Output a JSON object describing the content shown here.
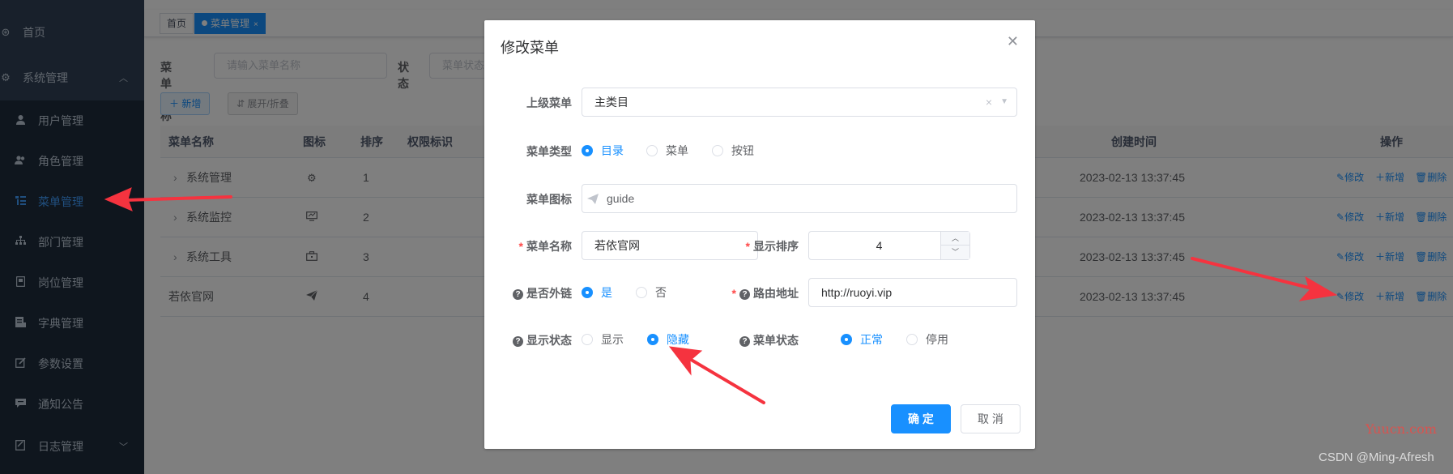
{
  "sidebar": {
    "home": "首页",
    "system": "系统管理",
    "items": [
      {
        "label": "用户管理",
        "icon": "user-icon"
      },
      {
        "label": "角色管理",
        "icon": "peoples-icon"
      },
      {
        "label": "菜单管理",
        "icon": "tree-table-icon",
        "active": true
      },
      {
        "label": "部门管理",
        "icon": "tree-icon"
      },
      {
        "label": "岗位管理",
        "icon": "post-icon"
      },
      {
        "label": "字典管理",
        "icon": "dict-icon"
      },
      {
        "label": "参数设置",
        "icon": "edit-icon"
      },
      {
        "label": "通知公告",
        "icon": "message-icon"
      },
      {
        "label": "日志管理",
        "icon": "log-icon"
      }
    ]
  },
  "tags": {
    "home": "首页",
    "current": "菜单管理",
    "close": "×"
  },
  "search": {
    "name_label": "菜单名称",
    "name_placeholder": "请输入菜单名称",
    "status_label": "状态",
    "status_placeholder": "菜单状态"
  },
  "toolbar": {
    "add": "＋ 新增",
    "expand": "⇵ 展开/折叠"
  },
  "table": {
    "headers": [
      "菜单名称",
      "图标",
      "排序",
      "权限标识",
      "创建时间",
      "操作"
    ],
    "rows": [
      {
        "name": "系统管理",
        "order": "1",
        "time": "2023-02-13 13:37:45"
      },
      {
        "name": "系统监控",
        "order": "2",
        "time": "2023-02-13 13:37:45"
      },
      {
        "name": "系统工具",
        "order": "3",
        "time": "2023-02-13 13:37:45"
      },
      {
        "name": "若依官网",
        "order": "4",
        "time": "2023-02-13 13:37:45"
      }
    ],
    "ops": {
      "edit": "修改",
      "add": "新增",
      "delete": "删除"
    }
  },
  "dialog": {
    "title": "修改菜单",
    "parent_label": "上级菜单",
    "parent_value": "主类目",
    "type_label": "菜单类型",
    "type_options": [
      "目录",
      "菜单",
      "按钮"
    ],
    "icon_label": "菜单图标",
    "icon_value": "guide",
    "name_label": "菜单名称",
    "name_value": "若依官网",
    "order_label": "显示排序",
    "order_value": "4",
    "link_label": "是否外链",
    "link_options": [
      "是",
      "否"
    ],
    "path_label": "路由地址",
    "path_value": "http://ruoyi.vip",
    "visible_label": "显示状态",
    "visible_options": [
      "显示",
      "隐藏"
    ],
    "status_label": "菜单状态",
    "status_options": [
      "正常",
      "停用"
    ],
    "ok": "确 定",
    "cancel": "取 消"
  },
  "watermarks": {
    "yuucn": "Yuucn.com",
    "csdn": "CSDN @Ming-Afresh"
  },
  "colors": {
    "primary": "#1890ff",
    "sidebar": "#304156",
    "submenu": "#1f2d3d",
    "arrow": "#f5333f",
    "danger": "#ff4949"
  }
}
